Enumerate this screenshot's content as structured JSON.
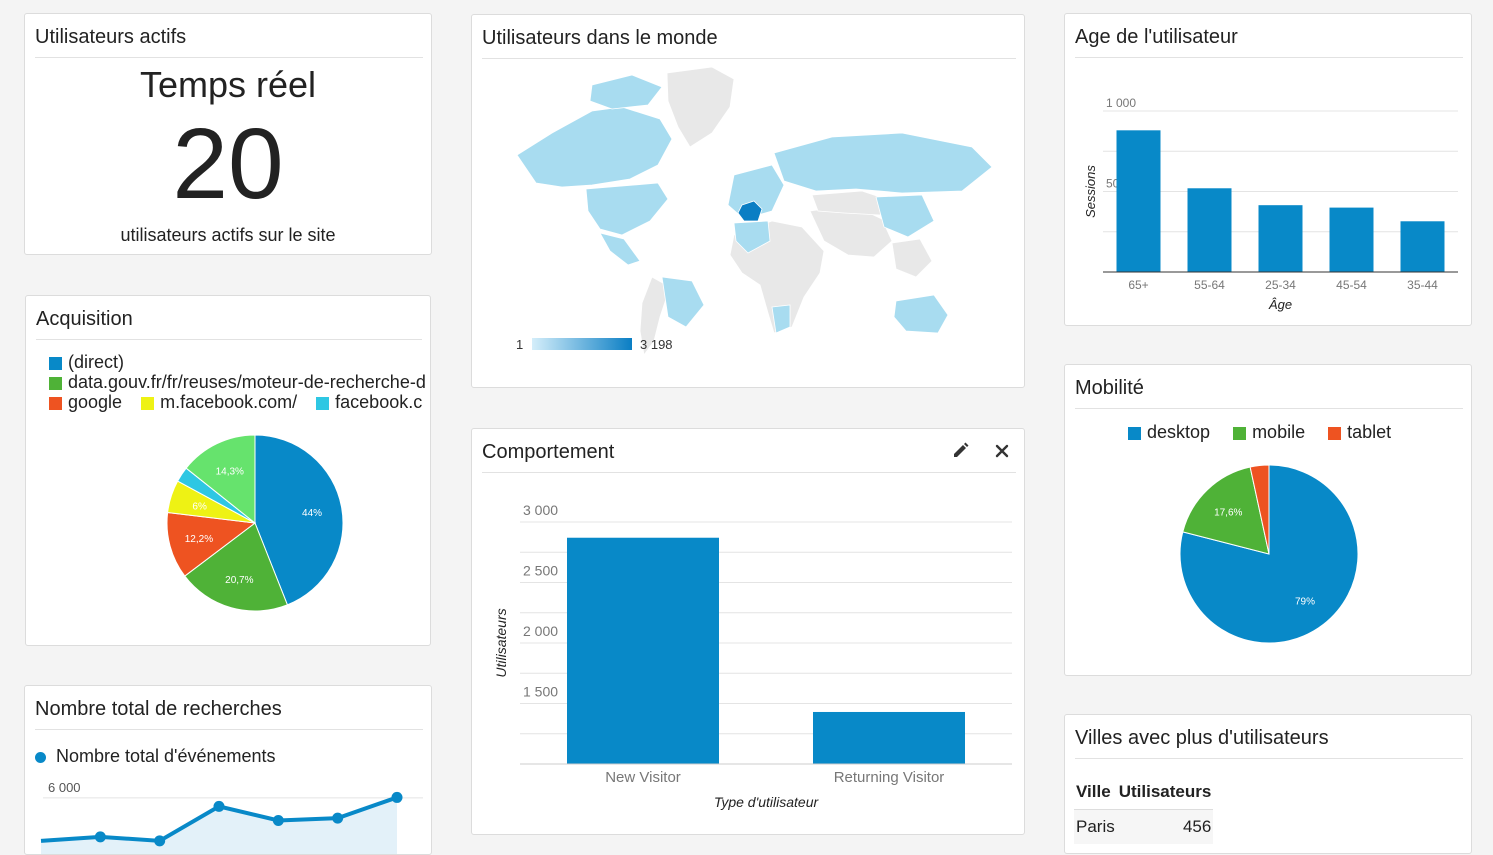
{
  "cards": {
    "active": {
      "title": "Utilisateurs actifs",
      "label": "Temps réel",
      "count": "20",
      "caption": "utilisateurs actifs sur le site"
    },
    "acquisition": {
      "title": "Acquisition",
      "legend": [
        "(direct)",
        "data.gouv.fr/fr/reuses/moteur-de-recherche-d",
        "google",
        "m.facebook.com/",
        "facebook.c"
      ]
    },
    "searches": {
      "title": "Nombre total de recherches",
      "legend": "Nombre total d'événements"
    },
    "world": {
      "title": "Utilisateurs dans le monde",
      "scale_min": "1",
      "scale_max": "3 198"
    },
    "behavior": {
      "title": "Comportement",
      "edit_icon": "pencil-icon",
      "close_icon": "close-icon"
    },
    "age": {
      "title": "Age de l'utilisateur"
    },
    "mobility": {
      "title": "Mobilité",
      "legend": [
        "desktop",
        "mobile",
        "tablet"
      ]
    },
    "cities": {
      "title": "Villes avec plus d'utilisateurs",
      "headers": [
        "Ville",
        "Utilisateurs"
      ],
      "rows": [
        [
          "Paris",
          "456"
        ]
      ]
    }
  },
  "colors": {
    "blue": "#0889c8",
    "green": "#4fb237",
    "orange": "#ee5321",
    "yellow": "#eef214",
    "cyan": "#2ec7e3",
    "lightgreen": "#66e36d",
    "maplight": "#a8dcf0",
    "mapdark": "#0a7ec4"
  },
  "chart_data": [
    {
      "id": "acquisition",
      "type": "pie",
      "slices": [
        {
          "label": "(direct)",
          "value": 44,
          "text": "44%"
        },
        {
          "label": "data.gouv.fr/fr/reuses/moteur-de-recherche-d",
          "value": 20.7,
          "text": "20,7%"
        },
        {
          "label": "google",
          "value": 12.2,
          "text": "12,2%"
        },
        {
          "label": "m.facebook.com/",
          "value": 6,
          "text": "6%"
        },
        {
          "label": "facebook.c",
          "value": 2.8,
          "text": ""
        },
        {
          "label": "other",
          "value": 14.3,
          "text": "14,3%"
        }
      ]
    },
    {
      "id": "behavior",
      "type": "bar",
      "categories": [
        "New Visitor",
        "Returning Visitor"
      ],
      "values": [
        2870,
        1430
      ],
      "ylabel": "Utilisateurs",
      "xlabel": "Type d'utilisateur",
      "yticks": [
        "3 000",
        "2 500",
        "2 000",
        "1 500"
      ],
      "ylim": [
        1000,
        3000
      ]
    },
    {
      "id": "age",
      "type": "bar",
      "categories": [
        "65+",
        "55-64",
        "25-34",
        "45-54",
        "35-44"
      ],
      "values": [
        880,
        520,
        415,
        400,
        315
      ],
      "ylabel": "Sessions",
      "xlabel": "Âge",
      "yticks": [
        "1 000",
        "500"
      ],
      "ylim": [
        0,
        1000
      ]
    },
    {
      "id": "mobility",
      "type": "pie",
      "slices": [
        {
          "label": "desktop",
          "value": 79,
          "text": "79%"
        },
        {
          "label": "mobile",
          "value": 17.6,
          "text": "17,6%"
        },
        {
          "label": "tablet",
          "value": 3.4,
          "text": ""
        }
      ]
    },
    {
      "id": "searches",
      "type": "area",
      "series": [
        {
          "name": "Nombre total d'événements",
          "values": [
            4900,
            5000,
            4900,
            5780,
            5420,
            5480,
            6010
          ]
        }
      ],
      "yticks": [
        "6 000"
      ],
      "ylim": [
        4000,
        6200
      ]
    }
  ]
}
